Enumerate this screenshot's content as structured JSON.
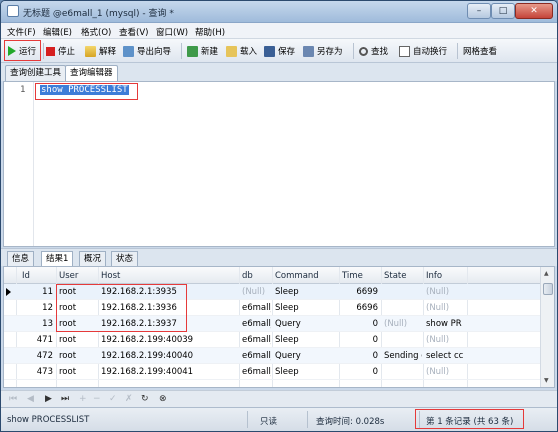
{
  "window": {
    "title": "无标题 @e6mall_1 (mysql) - 查询 *",
    "min_glyph": "–",
    "max_glyph": "□",
    "close_glyph": "✕"
  },
  "menu": [
    "文件(F)",
    "编辑(E)",
    "格式(O)",
    "查看(V)",
    "窗口(W)",
    "帮助(H)"
  ],
  "toolbar": {
    "run": "运行",
    "stop": "停止",
    "explain": "解释",
    "export_wizard": "导出向导",
    "new": "新建",
    "load": "载入",
    "save": "保存",
    "save_as": "另存为",
    "find": "查找",
    "word_wrap": "自动换行",
    "grid_view": "网格查看"
  },
  "editor_tabs": [
    "查询创建工具",
    "查询编辑器"
  ],
  "editor": {
    "line_number": "1",
    "sql": "show PROCESSLIST"
  },
  "result_tabs": [
    "信息",
    "结果1",
    "概况",
    "状态"
  ],
  "grid": {
    "columns": [
      "Id",
      "User",
      "Host",
      "db",
      "Command",
      "Time",
      "State",
      "Info"
    ],
    "rows": [
      {
        "id": "11",
        "user": "root",
        "host": "192.168.2.1:3935",
        "db": "(Null)",
        "command": "Sleep",
        "time": "6699",
        "state": "",
        "info": "(Null)"
      },
      {
        "id": "12",
        "user": "root",
        "host": "192.168.2.1:3936",
        "db": "e6mall_",
        "command": "Sleep",
        "time": "6696",
        "state": "",
        "info": "(Null)"
      },
      {
        "id": "13",
        "user": "root",
        "host": "192.168.2.1:3937",
        "db": "e6mall_",
        "command": "Query",
        "time": "0",
        "state": "(Null)",
        "info": "show PR"
      },
      {
        "id": "471",
        "user": "root",
        "host": "192.168.2.199:40039",
        "db": "e6mall_",
        "command": "Sleep",
        "time": "0",
        "state": "",
        "info": "(Null)"
      },
      {
        "id": "472",
        "user": "root",
        "host": "192.168.2.199:40040",
        "db": "e6mall_",
        "command": "Query",
        "time": "0",
        "state": "Sending c",
        "info": "select cc"
      },
      {
        "id": "473",
        "user": "root",
        "host": "192.168.2.199:40041",
        "db": "e6mall_",
        "command": "Sleep",
        "time": "0",
        "state": "",
        "info": "(Null)"
      }
    ]
  },
  "navbar": {
    "first": "⏮",
    "prev": "◀",
    "next": "▶",
    "last": "⏭",
    "add": "+",
    "delete": "−",
    "apply": "✓",
    "discard": "✗",
    "refresh": "↻",
    "stop": "⊗"
  },
  "status": {
    "query": "show PROCESSLIST",
    "mode": "只读",
    "query_time": "查询时间: 0.028s",
    "record_info": "第 1 条记录 (共 63 条)"
  }
}
